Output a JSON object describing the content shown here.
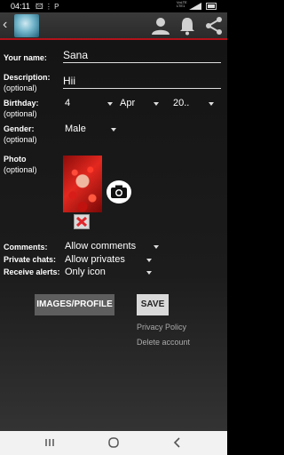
{
  "status_bar": {
    "time": "04:11",
    "notification_icons": "🖾 ⋮ P",
    "network": [
      "VoLTE",
      "LTE1"
    ]
  },
  "app_bar": {
    "back_icon": "back-arrow-icon",
    "avatar_icon": "app-avatar-icon",
    "actions": [
      "person-icon",
      "bell-icon",
      "share-icon"
    ]
  },
  "form": {
    "name": {
      "label": "Your name:",
      "value": "Sana"
    },
    "description": {
      "label": "Description:",
      "optional": "(optional)",
      "value": "Hii"
    },
    "birthday": {
      "label": "Birthday:",
      "optional": "(optional)",
      "day": "4",
      "month": "Apr",
      "year": "20.."
    },
    "gender": {
      "label": "Gender:",
      "optional": "(optional)",
      "value": "Male"
    },
    "photo": {
      "label": "Photo",
      "optional": "(optional)"
    },
    "comments": {
      "label": "Comments:",
      "value": "Allow comments"
    },
    "private_chats": {
      "label": "Private chats:",
      "value": "Allow privates"
    },
    "receive_alerts": {
      "label": "Receive alerts:",
      "value": "Only icon"
    }
  },
  "buttons": {
    "images_profile": "IMAGES/PROFILE",
    "save": "SAVE"
  },
  "links": {
    "privacy_policy": "Privacy Policy",
    "delete_account": "Delete account"
  },
  "colors": {
    "accent_red": "#b3121b",
    "background": "#141414"
  },
  "nav_bar": [
    "recents-icon",
    "home-icon",
    "back-icon"
  ]
}
